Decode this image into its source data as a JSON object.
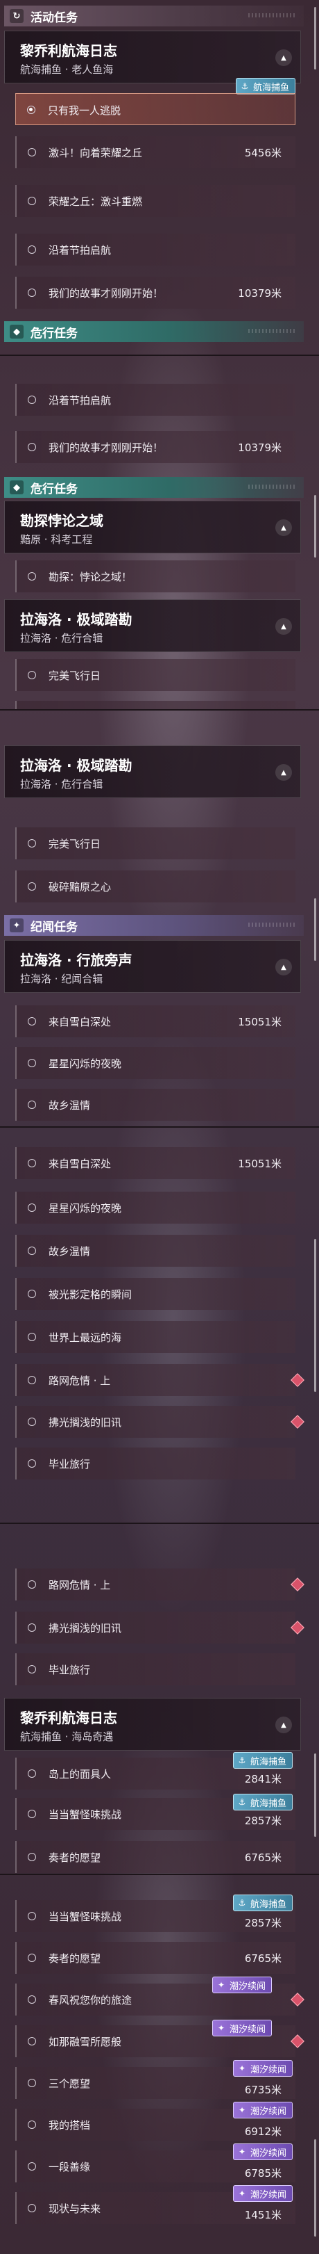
{
  "sections": {
    "activity": {
      "title": "活动任务",
      "icon": "↻"
    },
    "danger": {
      "title": "危行任务",
      "icon": "◆"
    },
    "legend": {
      "title": "纪闻任务",
      "icon": "✦"
    }
  },
  "groups": {
    "pq_log": {
      "title": "黎乔利航海日志",
      "subtitle": "航海捕鱼 · 老人鱼海"
    },
    "explore": {
      "title": "勘探悖论之域",
      "subtitle": "黯原 · 科考工程"
    },
    "lahailuo_polar": {
      "title": "拉海洛 · 极域踏勘",
      "subtitle": "拉海洛 · 危行合辑"
    },
    "lahailuo_walk": {
      "title": "拉海洛 · 行旅旁声",
      "subtitle": "拉海洛 · 纪闻合辑"
    },
    "pq_log2": {
      "title": "黎乔利航海日志",
      "subtitle": "航海捕鱼 · 海岛奇遇"
    }
  },
  "items": {
    "escape": "只有我一人逃脱",
    "charge": "激斗！向着荣耀之丘",
    "glory": "荣耀之丘：激斗重燃",
    "festival": "沿着节拍启航",
    "story": "我们的故事才刚刚开始！",
    "paradox": "勘探：悖论之域！",
    "flight": "完美飞行日",
    "break": "破碎黯原之心",
    "snow": "来自雪白深处",
    "stars": "星星闪烁的夜晚",
    "old": "故乡温情",
    "moment": "被光影定格的瞬间",
    "farthest": "世界上最远的海",
    "road": "路网危情 · 上",
    "shallow": "拂光搁浅的旧讯",
    "grad": "毕业旅行",
    "islander": "岛上的面具人",
    "monster": "当当蟹怪味挑战",
    "wish": "奏者的愿望",
    "spring": "春风祝您你的旅途",
    "snowmelt": "如那融雪所愿般",
    "three": "三个愿望",
    "trick": "我的搭档",
    "shell": "一段善缘",
    "reality": "现状与未来"
  },
  "distances": {
    "charge": "5456米",
    "story": "10379米",
    "snow": "15051米",
    "islander": "2841米",
    "monster": "2857米",
    "wish": "6765米",
    "three": "6735米",
    "trick": "6912米",
    "shell": "6785米",
    "reality": "1451米"
  },
  "badges": {
    "fish": "航海捕鱼",
    "tide": "潮汐续闻"
  },
  "colors": {
    "activity_header": "#6c5665",
    "danger_header": "#3e8d86",
    "legend_header": "#7b6fa6",
    "selected_item": "#b45a46",
    "marker": "#d9536a",
    "badge_fish": "#5ea7c6",
    "badge_tide": "#9a73d8"
  }
}
